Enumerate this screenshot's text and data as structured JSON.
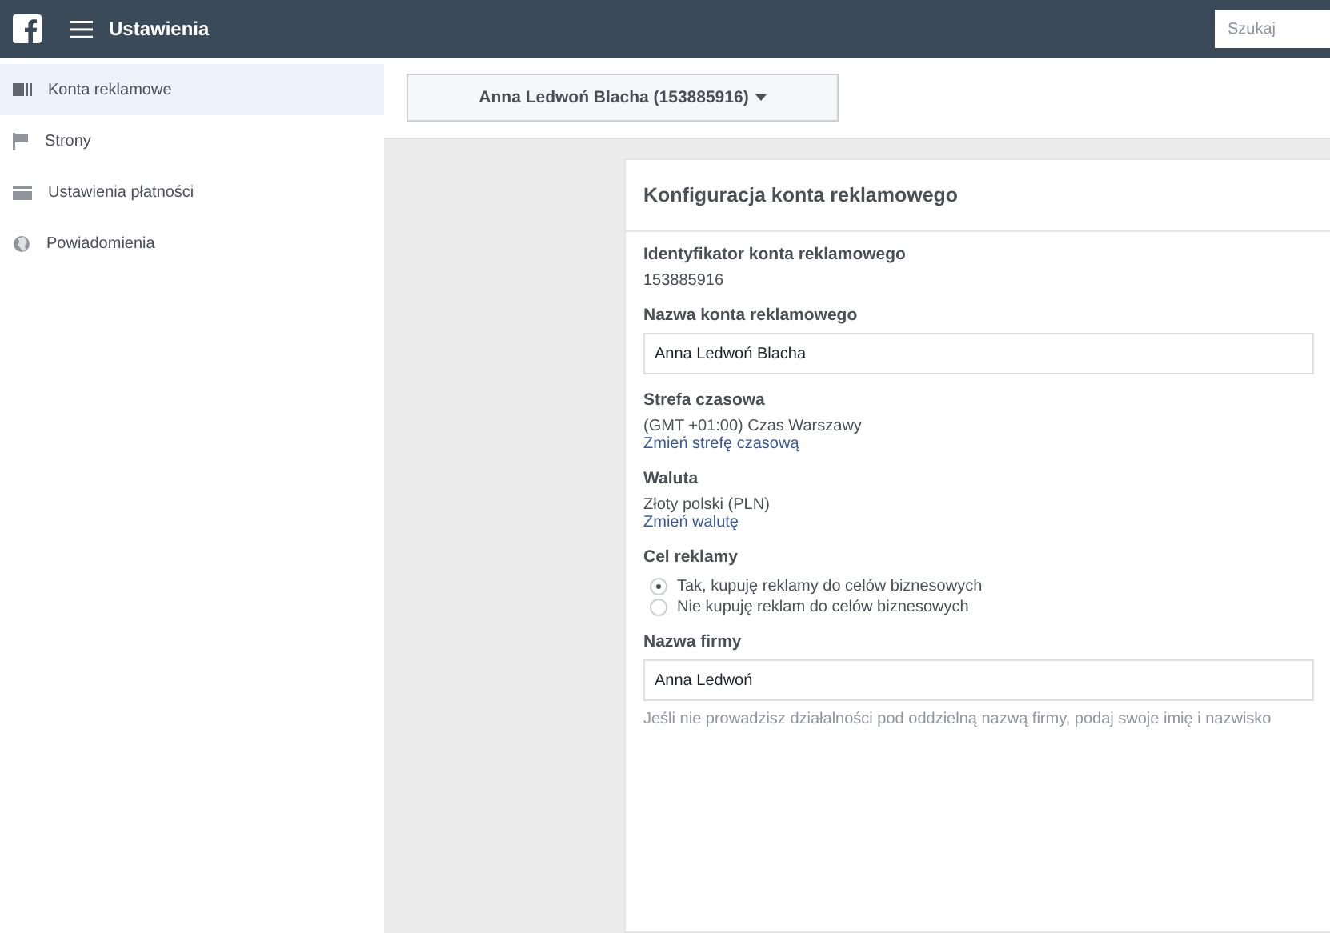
{
  "header": {
    "title": "Ustawienia",
    "search": {
      "placeholder": "Szukaj"
    }
  },
  "sidebar": {
    "items": [
      {
        "label": "Konta reklamowe",
        "kind": "card",
        "selected": true
      },
      {
        "label": "Strony",
        "kind": "flag",
        "selected": false
      },
      {
        "label": "Ustawienia płatności",
        "kind": "payment",
        "selected": false
      },
      {
        "label": "Powiadomienia",
        "kind": "globe",
        "selected": false
      }
    ]
  },
  "account_selector": {
    "label": "Anna Ledwoń Blacha (153885916)"
  },
  "card": {
    "title": "Konfiguracja konta reklamowego",
    "sections": [
      {
        "kind": "text",
        "label": "Identyfikator konta reklamowego",
        "value": "153885916"
      },
      {
        "kind": "input",
        "label": "Nazwa konta reklamowego",
        "value": "Anna Ledwoń Blacha"
      },
      {
        "kind": "text",
        "label": "Strefa czasowa",
        "value": "(GMT +01:00) Czas Warszawy",
        "link": "Zmień strefę czasową"
      },
      {
        "kind": "text",
        "label": "Waluta",
        "value": "Złoty polski (PLN)",
        "link": "Zmień walutę"
      },
      {
        "kind": "radio",
        "label": "Cel reklamy",
        "options": [
          {
            "label": "Tak, kupuję reklamy do celów biznesowych",
            "selected": true
          },
          {
            "label": "Nie kupuję reklam do celów biznesowych",
            "selected": false
          }
        ]
      },
      {
        "kind": "input",
        "label": "Nazwa firmy",
        "value": "Anna Ledwoń",
        "hint": "Jeśli nie prowadzisz działalności pod oddzielną nazwą firmy, podaj swoje imię i nazwisko"
      }
    ]
  }
}
